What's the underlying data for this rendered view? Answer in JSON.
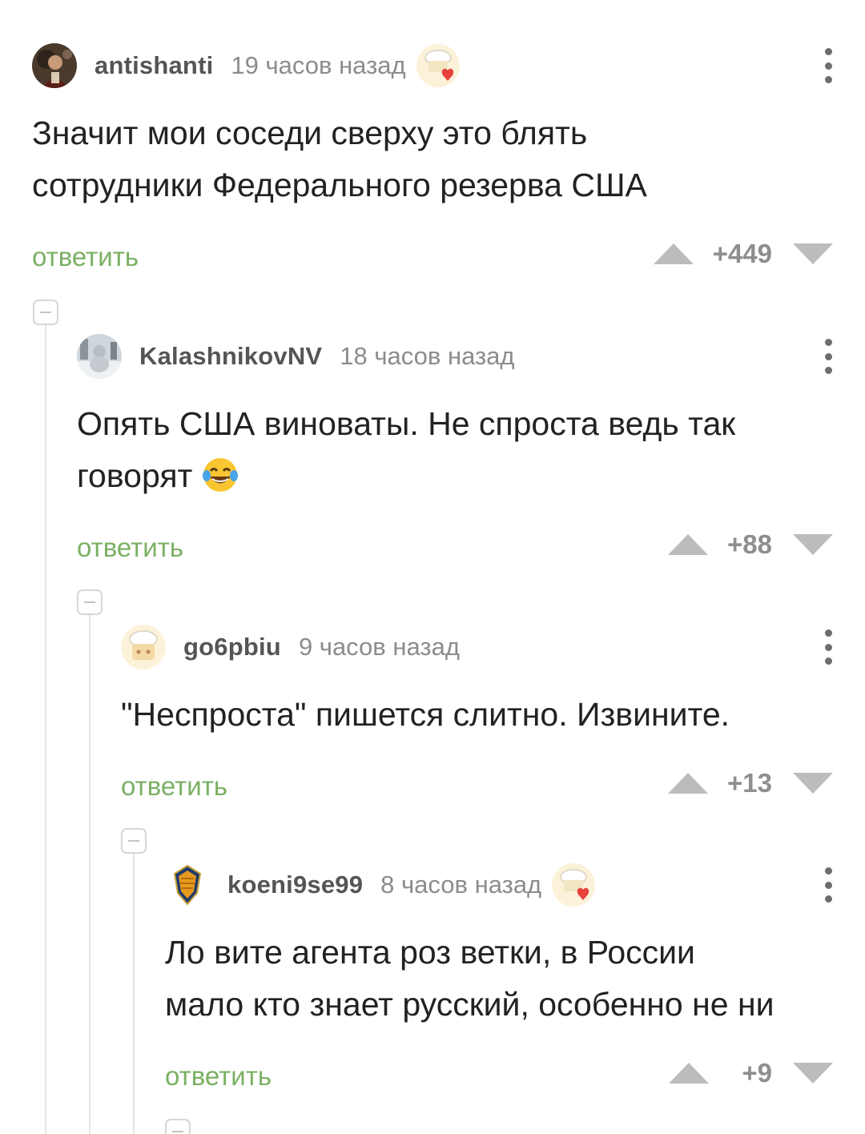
{
  "comments": [
    {
      "author": "antishanti",
      "time": "19 часов назад",
      "text_lines": [
        "Значит мои соседи сверху это блять",
        "сотрудники Федерального резерва США"
      ],
      "reply_label": "ответить",
      "rating": "+449"
    },
    {
      "author": "KalashnikovNV",
      "time": "18 часов назад",
      "text_lines": [
        "Опять США виноваты. Не спроста ведь так",
        "говорят"
      ],
      "emoji": "😂",
      "reply_label": "ответить",
      "rating": "+88"
    },
    {
      "author": "go6pbiu",
      "time": "9 часов назад",
      "text_lines": [
        "\"Неспроста\" пишется слитно. Извините."
      ],
      "reply_label": "ответить",
      "rating": "+13"
    },
    {
      "author": "koeni9se99",
      "time": "8 часов назад",
      "text_lines": [
        "Ло вите агента роз ветки, в России",
        "мало кто знает русский, особенно не ни"
      ],
      "reply_label": "ответить",
      "rating": "+9"
    }
  ],
  "colors": {
    "reply": "#7bb063",
    "vote_arrow": "#bcbcbc",
    "author": "#555555",
    "time": "#8c8c8c",
    "thread_line": "#e4e4e4"
  },
  "icons": {
    "badge": "chef-hat-heart-icon",
    "menu": "more-vertical-icon",
    "upvote": "upvote-triangle-icon",
    "downvote": "downvote-triangle-icon",
    "collapse": "collapse-minus-icon"
  }
}
